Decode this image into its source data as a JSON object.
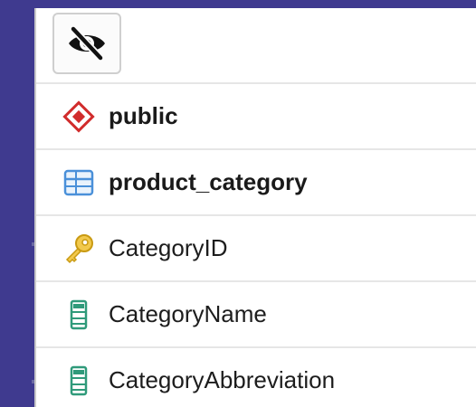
{
  "tree": {
    "toggle_icon": "eye-slash-icon",
    "items": [
      {
        "label": "public",
        "icon": "schema-diamond-icon",
        "color": "#d12c2c"
      },
      {
        "label": "product_category",
        "icon": "table-grid-icon",
        "color": "#4a90d9"
      },
      {
        "label": "CategoryID",
        "icon": "primary-key-icon",
        "color": "#e8b21a"
      },
      {
        "label": "CategoryName",
        "icon": "column-icon",
        "color": "#2f9a7a"
      },
      {
        "label": "CategoryAbbreviation",
        "icon": "column-icon",
        "color": "#2f9a7a"
      }
    ]
  }
}
